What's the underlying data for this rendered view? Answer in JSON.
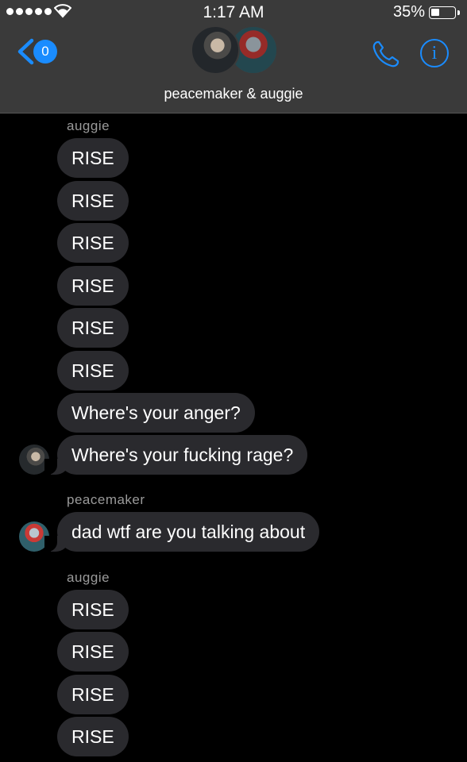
{
  "status_bar": {
    "time": "1:17 AM",
    "battery": "35%",
    "signal_icon": "signal-dots-icon",
    "wifi_icon": "wifi-icon"
  },
  "header": {
    "back_badge": "0",
    "title": "peacemaker & auggie",
    "call_icon": "phone-icon",
    "info_icon": "info-icon"
  },
  "messages": [
    {
      "sender": "auggie"
    },
    {
      "text": "RISE"
    },
    {
      "text": "RISE"
    },
    {
      "text": "RISE"
    },
    {
      "text": "RISE"
    },
    {
      "text": "RISE"
    },
    {
      "text": "RISE"
    },
    {
      "text": "Where's your anger?"
    },
    {
      "text": "Where's your fucking rage?"
    },
    {
      "sender": "peacemaker"
    },
    {
      "text": "dad wtf are you talking about"
    },
    {
      "sender": "auggie"
    },
    {
      "text": "RISE"
    },
    {
      "text": "RISE"
    },
    {
      "text": "RISE"
    },
    {
      "text": "RISE"
    }
  ],
  "colors": {
    "accent": "#1a8cff",
    "header_bg": "#3a3a3a",
    "bubble_bg": "#2a2a2e",
    "sender_label": "#9a9a9a"
  }
}
